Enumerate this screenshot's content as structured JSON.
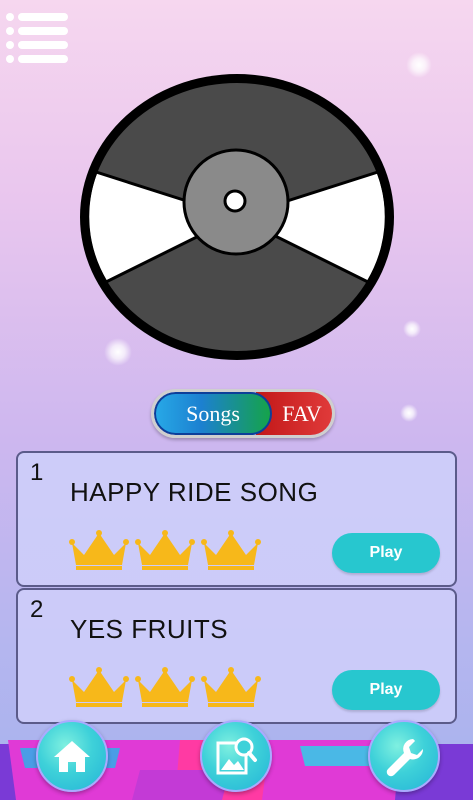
{
  "tabs": {
    "songs_label": "Songs",
    "fav_label": "FAV"
  },
  "songs": [
    {
      "number": "1",
      "title": "HAPPY RIDE SONG",
      "crowns": 3,
      "play_label": "Play"
    },
    {
      "number": "2",
      "title": "YES FRUITS",
      "crowns": 3,
      "play_label": "Play"
    }
  ],
  "colors": {
    "crown": "#f7b81a",
    "play_button": "#27c7cf",
    "record_dark": "#4a4a4a"
  },
  "nav": {
    "items": [
      {
        "name": "home-icon"
      },
      {
        "name": "image-search-icon"
      },
      {
        "name": "wrench-icon"
      }
    ]
  }
}
